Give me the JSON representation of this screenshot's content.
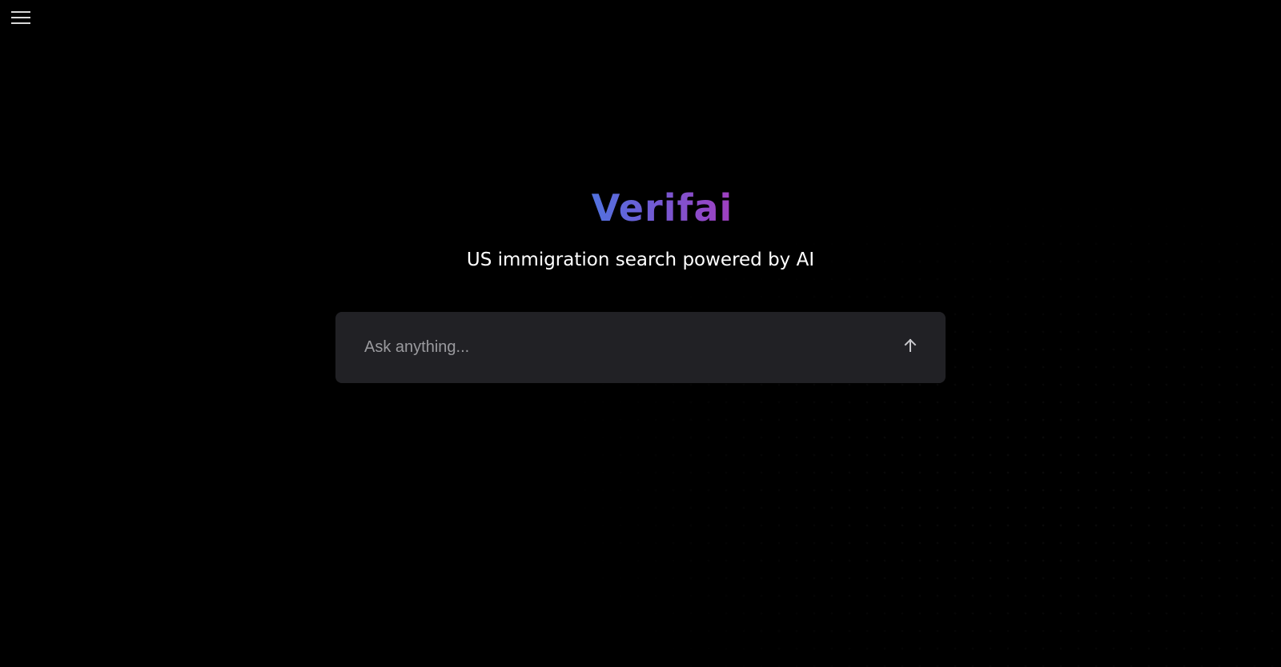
{
  "header": {
    "menu_icon": "hamburger-menu-icon"
  },
  "hero": {
    "title": "Verifai",
    "tagline": "US immigration search powered by AI"
  },
  "search": {
    "placeholder": "Ask anything...",
    "value": "",
    "submit_icon": "arrow-up-icon"
  },
  "colors": {
    "background": "#000000",
    "search_box": "#212125",
    "title_gradient_start": "#3b82e6",
    "title_gradient_end": "#a13fc1",
    "tagline": "#ffffff",
    "placeholder": "#9a9a9e"
  }
}
